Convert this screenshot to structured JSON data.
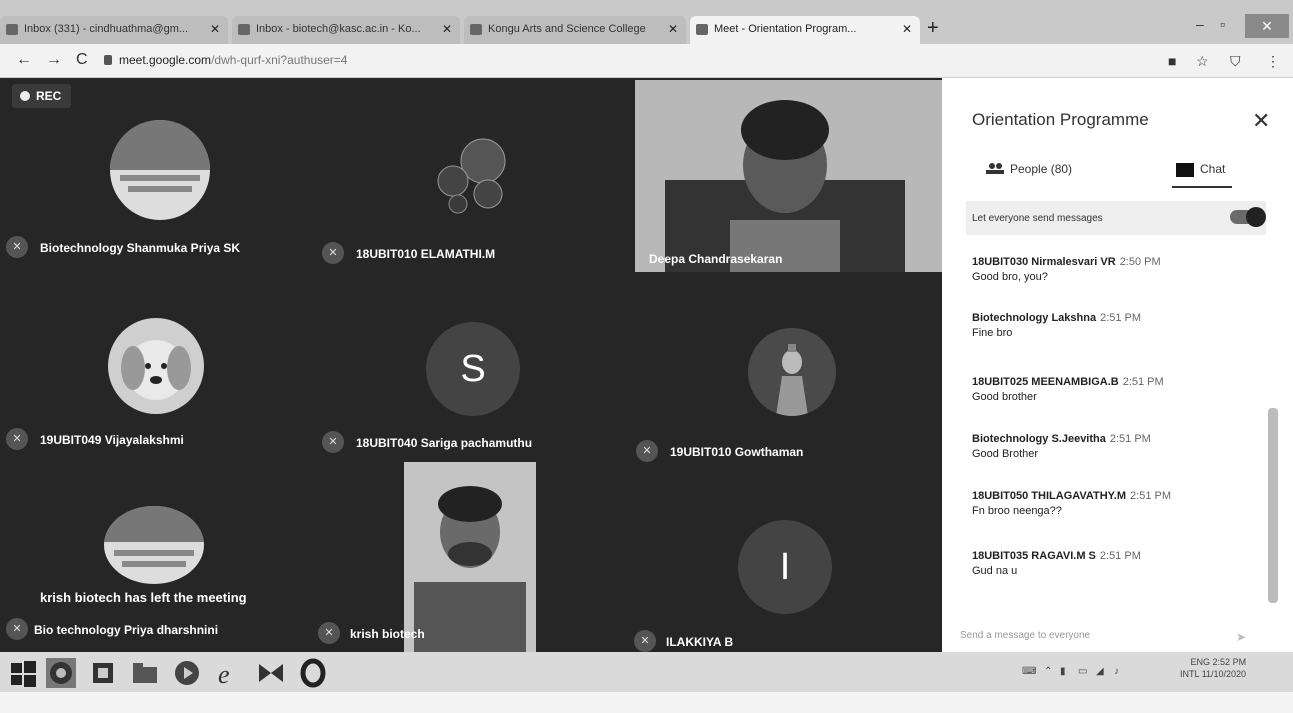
{
  "browser": {
    "tabs": [
      {
        "title": "Inbox (331) - cindhuathma@gm...",
        "active": false
      },
      {
        "title": "Inbox - biotech@kasc.ac.in - Ko...",
        "active": false
      },
      {
        "title": "Kongu Arts and Science College",
        "active": false
      },
      {
        "title": "Meet - Orientation Program...",
        "active": true
      }
    ],
    "url_host": "meet.google.com",
    "url_path": "/dwh-qurf-xni?authuser=4"
  },
  "meet": {
    "rec_label": "REC",
    "participants": [
      {
        "name": "Biotechnology Shanmuka Priya SK",
        "type": "image",
        "icon": "biotech-logo"
      },
      {
        "name": "18UBIT010 ELAMATHI.M",
        "type": "image",
        "icon": "bubbles-image"
      },
      {
        "name": "Deepa Chandrasekaran",
        "type": "video"
      },
      {
        "name": "19UBIT049 Vijayalakshmi",
        "type": "image",
        "icon": "puppy-image"
      },
      {
        "name": "18UBIT040 Sariga pachamuthu",
        "type": "letter",
        "letter": "S"
      },
      {
        "name": "19UBIT010 Gowthaman",
        "type": "image",
        "icon": "deity-image"
      },
      {
        "name": "Bio technology Priya dharshnini",
        "type": "image",
        "icon": "biotech-logo"
      },
      {
        "name": "krish biotech",
        "type": "video"
      },
      {
        "name": "ILAKKIYA B",
        "type": "letter",
        "letter": "I"
      }
    ],
    "left_message": "krish biotech has left the meeting"
  },
  "panel": {
    "title": "Orientation Programme",
    "people_tab": "People (80)",
    "chat_tab": "Chat",
    "setting_label": "Let everyone send messages",
    "messages": [
      {
        "sender": "18UBIT030 Nirmalesvari VR",
        "time": "2:50 PM",
        "text": "Good bro, you?"
      },
      {
        "sender": "Biotechnology Lakshna",
        "time": "2:51 PM",
        "text": "Fine bro"
      },
      {
        "sender": "18UBIT025 MEENAMBIGA.B",
        "time": "2:51 PM",
        "text": "Good brother"
      },
      {
        "sender": "Biotechnology S.Jeevitha",
        "time": "2:51 PM",
        "text": "Good Brother"
      },
      {
        "sender": "18UBIT050 THILAGAVATHY.M",
        "time": "2:51 PM",
        "text": "Fn broo neenga??"
      },
      {
        "sender": "18UBIT035 RAGAVI.M S",
        "time": "2:51 PM",
        "text": "Gud na u"
      }
    ],
    "compose_placeholder": "Send a message to everyone"
  },
  "taskbar": {
    "lang": "ENG",
    "lang2": "INTL",
    "clock_time": "2:52 PM",
    "clock_date": "11/10/2020"
  }
}
